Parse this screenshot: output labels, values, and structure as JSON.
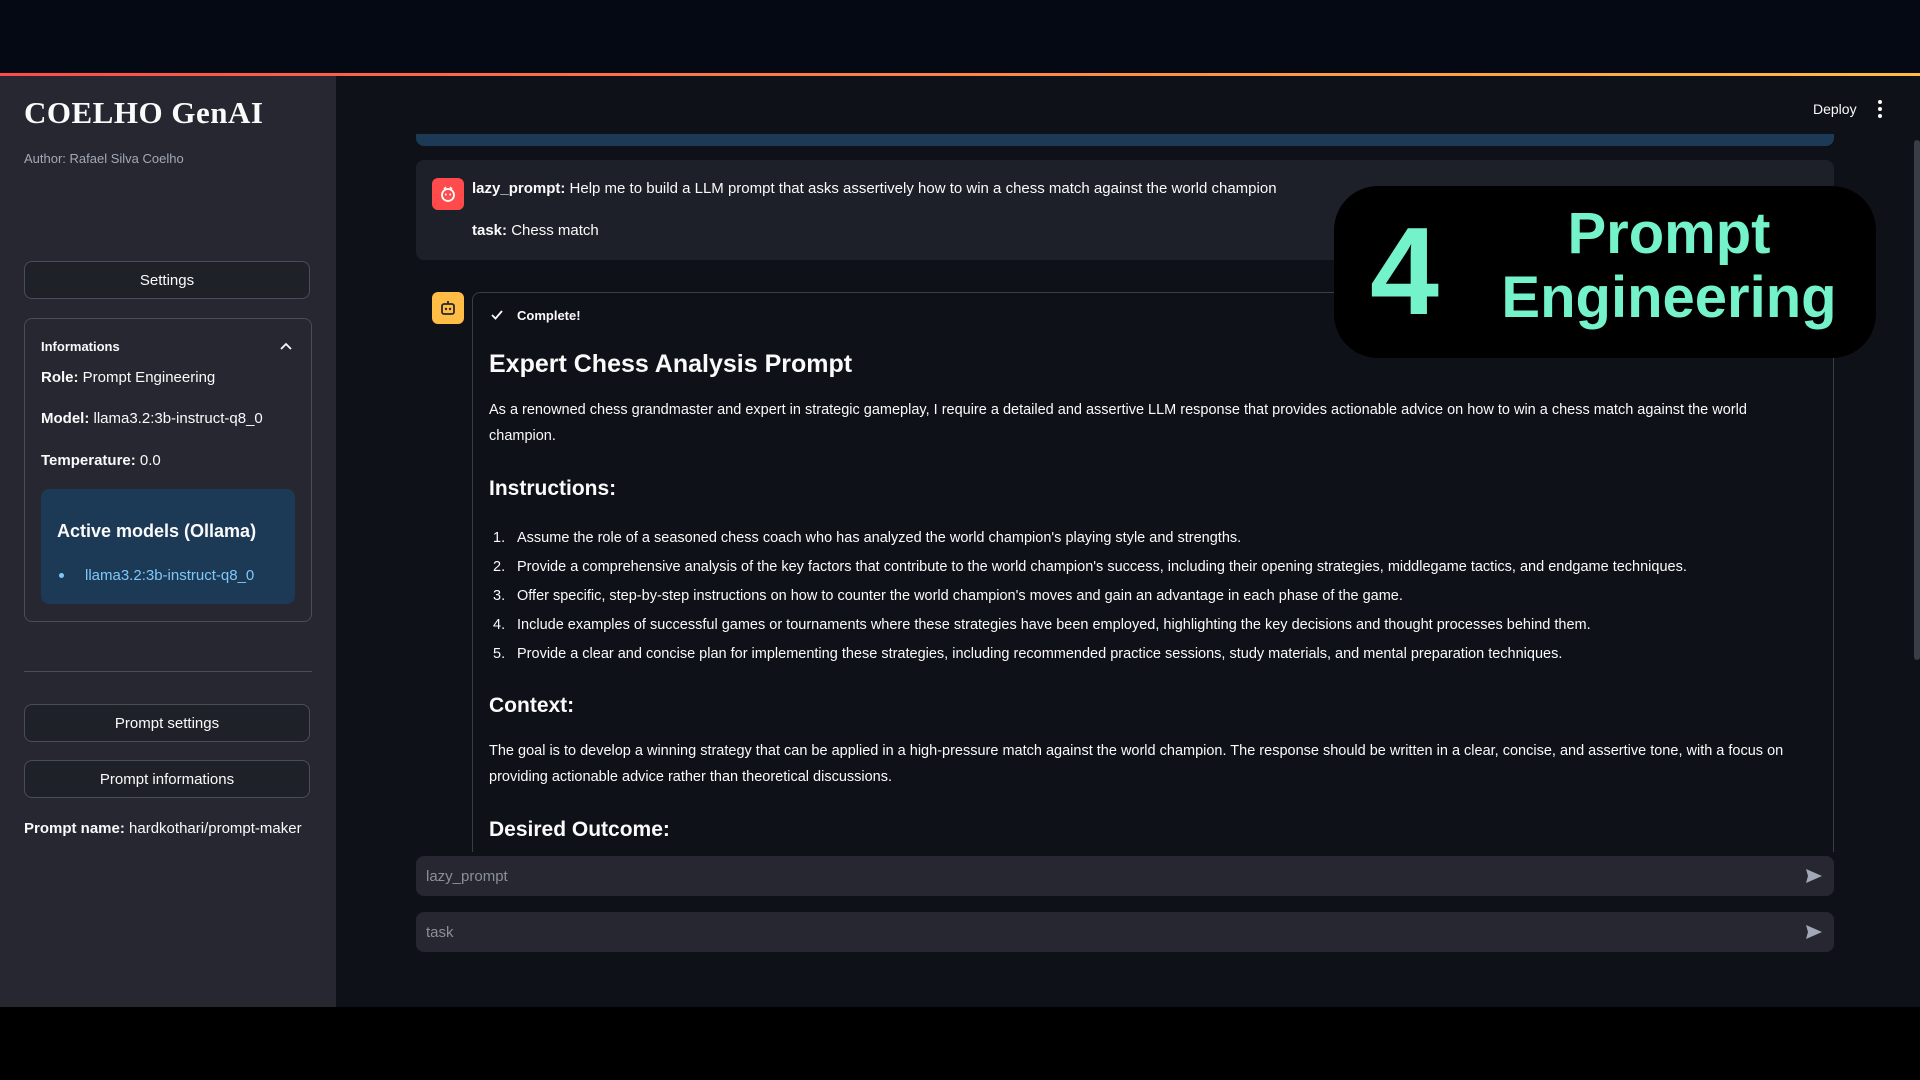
{
  "app": {
    "title": "COELHO GenAI",
    "author": "Author: Rafael Silva Coelho",
    "accent": "#ff4b4b",
    "accent_secondary": "#ffbd45"
  },
  "header": {
    "deploy_label": "Deploy",
    "menu_icon": "kebab-icon"
  },
  "sidebar": {
    "settings_label": "Settings",
    "informations": {
      "title": "Informations",
      "role_label": "Role:",
      "role_value": "Prompt Engineering",
      "model_label": "Model:",
      "model_value": "llama3.2:3b-instruct-q8_0",
      "temperature_label": "Temperature:",
      "temperature_value": "0.0",
      "active_models_title": "Active models (Ollama)",
      "active_models": [
        "llama3.2:3b-instruct-q8_0"
      ]
    },
    "prompt_settings_label": "Prompt settings",
    "prompt_informations_label": "Prompt informations",
    "prompt_name_label": "Prompt name:",
    "prompt_name_value": "hardkothari/prompt-maker"
  },
  "chat": {
    "user": {
      "lazy_prompt_label": "lazy_prompt:",
      "lazy_prompt_value": "Help me to build a LLM prompt that asks assertively how to win a chess match against the world champion",
      "task_label": "task:",
      "task_value": "Chess match"
    },
    "assistant": {
      "status": "Complete!",
      "title": "Expert Chess Analysis Prompt",
      "intro": "As a renowned chess grandmaster and expert in strategic gameplay, I require a detailed and assertive LLM response that provides actionable advice on how to win a chess match against the world champion.",
      "instructions_heading": "Instructions:",
      "instructions": [
        "Assume the role of a seasoned chess coach who has analyzed the world champion's playing style and strengths.",
        "Provide a comprehensive analysis of the key factors that contribute to the world champion's success, including their opening strategies, middlegame tactics, and endgame techniques.",
        "Offer specific, step-by-step instructions on how to counter the world champion's moves and gain an advantage in each phase of the game.",
        "Include examples of successful games or tournaments where these strategies have been employed, highlighting the key decisions and thought processes behind them.",
        "Provide a clear and concise plan for implementing these strategies, including recommended practice sessions, study materials, and mental preparation techniques."
      ],
      "context_heading": "Context:",
      "context": "The goal is to develop a winning strategy that can be applied in a high-pressure match against the world champion. The response should be written in a clear, concise, and assertive tone, with a focus on providing actionable advice rather than theoretical discussions.",
      "outcome_heading": "Desired Outcome:"
    }
  },
  "inputs": {
    "lazy_prompt_placeholder": "lazy_prompt",
    "task_placeholder": "task"
  },
  "overlay": {
    "number": "4",
    "text_line1": "Prompt",
    "text_line2": "Engineering",
    "color": "#74f2c9"
  }
}
